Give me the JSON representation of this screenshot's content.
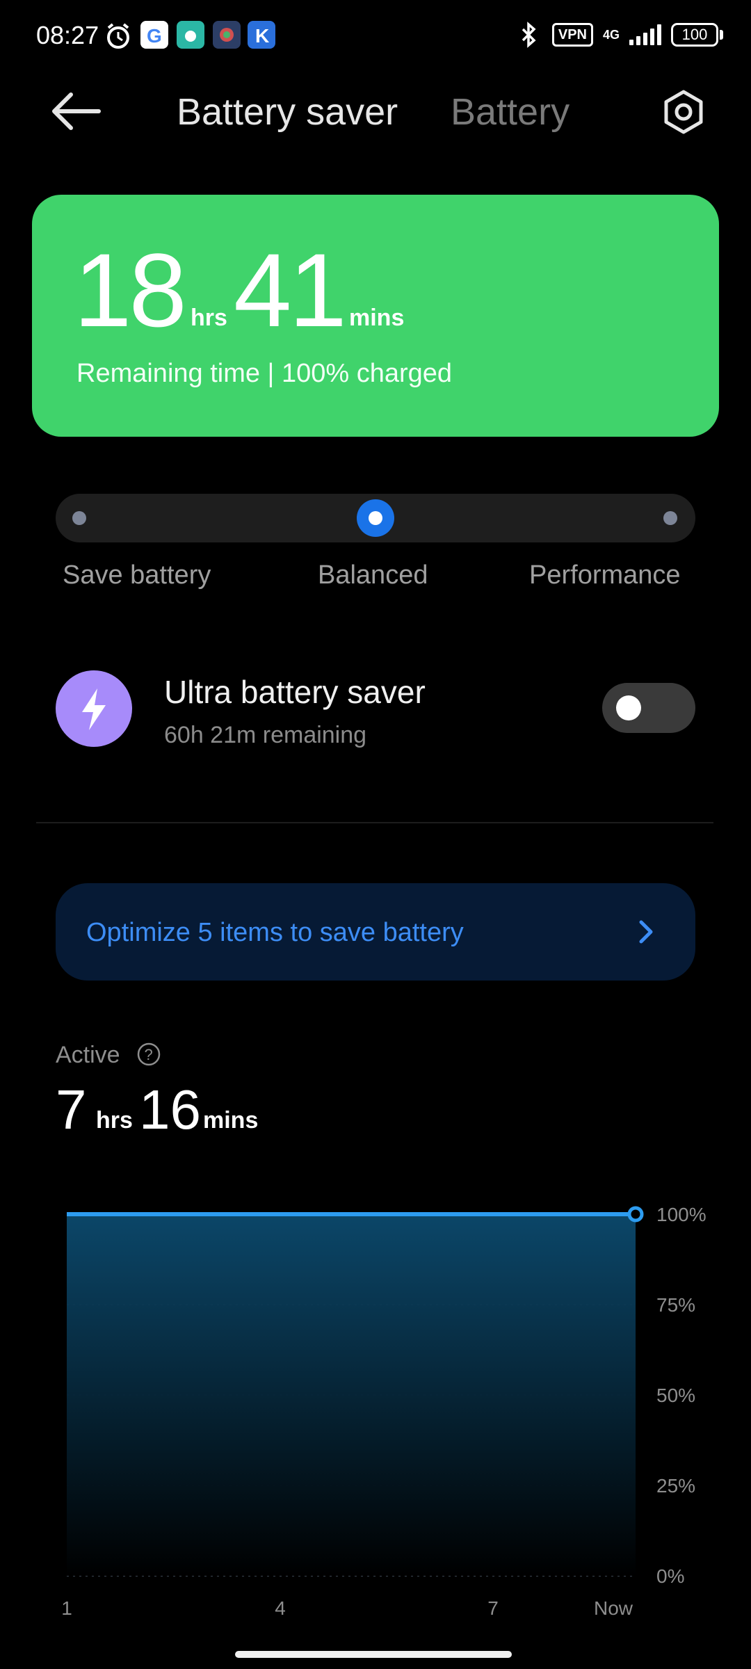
{
  "status_bar": {
    "time": "08:27",
    "app_icons": [
      {
        "name": "alarm-icon"
      },
      {
        "name": "google-icon",
        "color": "#ffffff"
      },
      {
        "name": "app-icon-1",
        "color": "#2bb7a5"
      },
      {
        "name": "app-icon-2",
        "color": "#2c3e66"
      },
      {
        "name": "app-icon-3",
        "color": "#2a6fdb"
      }
    ],
    "vpn_label": "VPN",
    "network_label": "4G",
    "battery_level": "100"
  },
  "header": {
    "tabs": [
      {
        "label": "Battery saver",
        "active": true
      },
      {
        "label": "Battery",
        "active": false
      }
    ]
  },
  "summary": {
    "hours": "18",
    "hours_unit": "hrs",
    "minutes": "41",
    "minutes_unit": "mins",
    "subtitle": "Remaining time | 100% charged",
    "card_color": "#40d36b"
  },
  "modes": {
    "options": [
      "Save battery",
      "Balanced",
      "Performance"
    ],
    "selected": "Balanced",
    "accent": "#1a73e8"
  },
  "ultra_saver": {
    "title": "Ultra battery saver",
    "subtitle": "60h 21m remaining",
    "enabled": false,
    "icon_color": "#a78bfa"
  },
  "optimize": {
    "label": "Optimize 5 items to save battery",
    "text_color": "#3d8df5"
  },
  "active": {
    "label": "Active",
    "hours": "7",
    "hours_unit": "hrs",
    "minutes": "16",
    "minutes_unit": "mins"
  },
  "chart_data": {
    "type": "area",
    "x_ticks": [
      "1",
      "4",
      "7",
      "Now"
    ],
    "y_ticks": [
      "100%",
      "75%",
      "50%",
      "25%",
      "0%"
    ],
    "ylim": [
      0,
      100
    ],
    "series": [
      {
        "values": [
          100,
          100,
          100,
          100
        ],
        "color": "#2d9cf0"
      }
    ],
    "grid": true
  }
}
